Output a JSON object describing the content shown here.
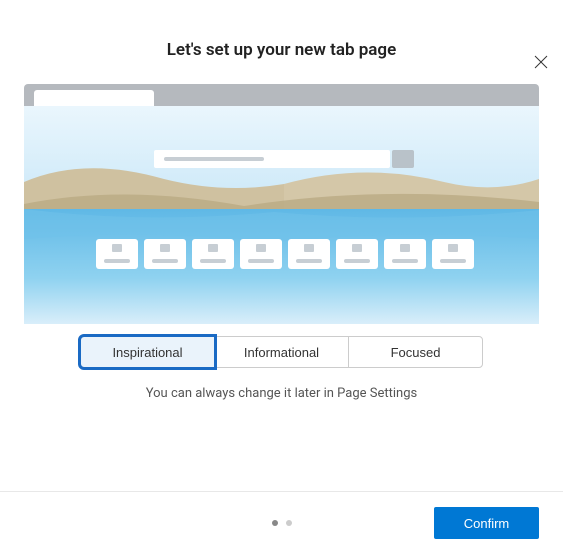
{
  "header": {
    "title": "Let's set up your new tab page"
  },
  "options": {
    "inspirational": "Inspirational",
    "informational": "Informational",
    "focused": "Focused"
  },
  "helper": "You can always change it later in Page Settings",
  "footer": {
    "confirm_label": "Confirm"
  }
}
